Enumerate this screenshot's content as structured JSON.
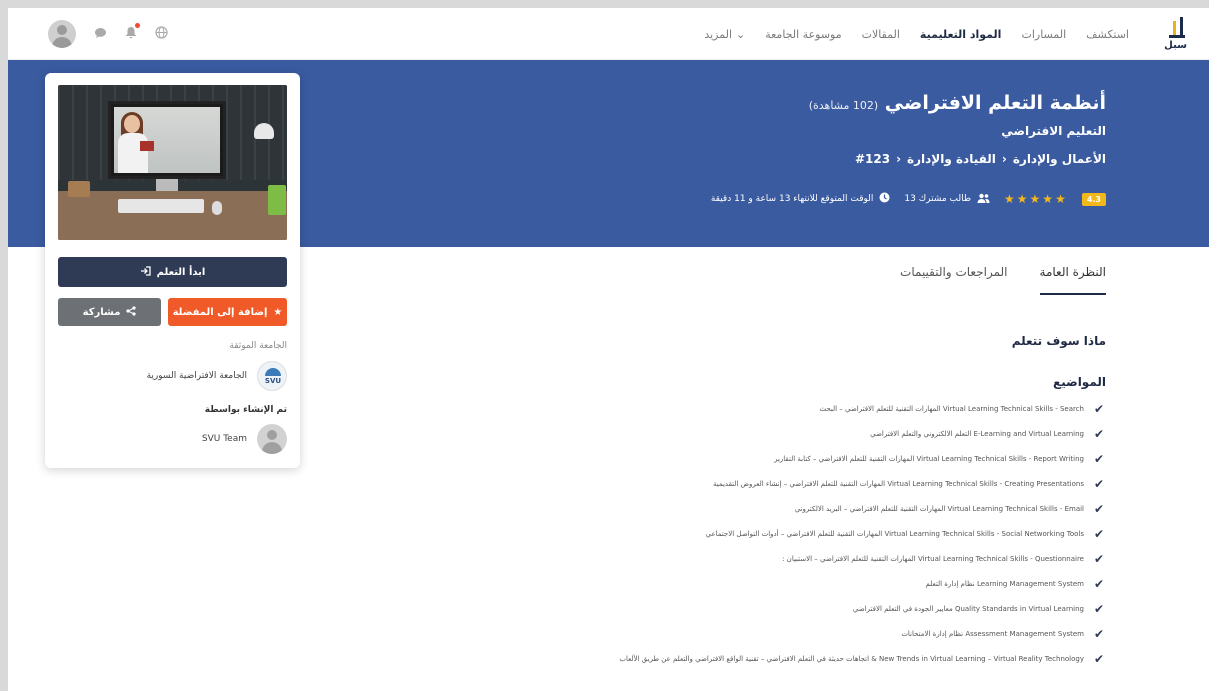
{
  "nav": {
    "logo_text": "سبل",
    "links": [
      "استكشف",
      "المسارات",
      "المواد التعليمية",
      "المقالات",
      "موسوعة الجامعة"
    ],
    "active_link": "المواد التعليمية",
    "more_label": "المزيد",
    "more_chevron": "⌄",
    "icons": [
      "globe-icon",
      "bell-icon",
      "chat-icon",
      "avatar"
    ]
  },
  "hero": {
    "title": "أنظمة التعلم الافتراضي",
    "views": "(102 مشاهدة)",
    "subtitle": "التعليم الافتراضي",
    "breadcrumb": [
      "الأعمال والإدارة",
      "القيادة والإدارة",
      "#123"
    ],
    "breadcrumb_sep": "›",
    "rating": "4.3",
    "stars": "★★★★★",
    "students": "13 طالب مشترك",
    "duration": "الوقت المتوقع للانتهاء 13 ساعة و 11 دقيقة"
  },
  "tabs": [
    {
      "label": "النظرة العامة",
      "active": true
    },
    {
      "label": "المراجعات والتقييمات",
      "active": false
    }
  ],
  "content": {
    "learn_title": "ماذا سوف تتعلم",
    "topics_title": "المواضيع",
    "topics": [
      "المهارات التقنية للتعلم الافتراضي – البحث Virtual Learning Technical Skills - Search",
      "التعلم الالكتروني والتعلم الافتراضي E-Learning and Virtual Learning",
      "المهارات التقنية للتعلم الافتراضي – كتابة التقارير Virtual Learning Technical Skills - Report Writing",
      "المهارات التقنية للتعلم الافتراضي – إنشاء العروض التقديمية Virtual Learning Technical Skills - Creating Presentations",
      "المهارات التقنية للتعلم الافتراضي – البريد الالكتروني Virtual Learning Technical Skills - Email",
      "المهارات التقنية للتعلم الافتراضي – أدوات التواصل الاجتماعي Virtual Learning Technical Skills - Social Networking Tools",
      ": المهارات التقنية للتعلم الافتراضي – الاستبيان Virtual Learning Technical Skills - Questionnaire",
      "نظام إدارة التعلم Learning Management System",
      "معايير الجودة في التعلم الافتراضي Quality Standards in Virtual Learning",
      "نظام إدارة الامتحانات Assessment Management System",
      "اتجاهات حديثة في التعلم الافتراضي – تقنية الواقع الافتراضي والتعلم عن طريق الألعاب & New Trends in Virtual Learning – Virtual Reality Technology"
    ]
  },
  "card": {
    "start_label": "ابدأ التعلم",
    "fav_label": "إضافة إلى المفضلة",
    "share_label": "مشاركة",
    "accredited_label": "الجامعة الموثقة",
    "university": "الجامعة الافتراضية السورية",
    "university_logo_text": "SVU",
    "created_by_label": "تم الإنشاء بواسطة",
    "creator": "SVU Team"
  },
  "colors": {
    "hero_bg": "#3a5ba0",
    "primary_dark": "#2f3b55",
    "accent_orange": "#f05a28",
    "star_yellow": "#f2b81b"
  }
}
